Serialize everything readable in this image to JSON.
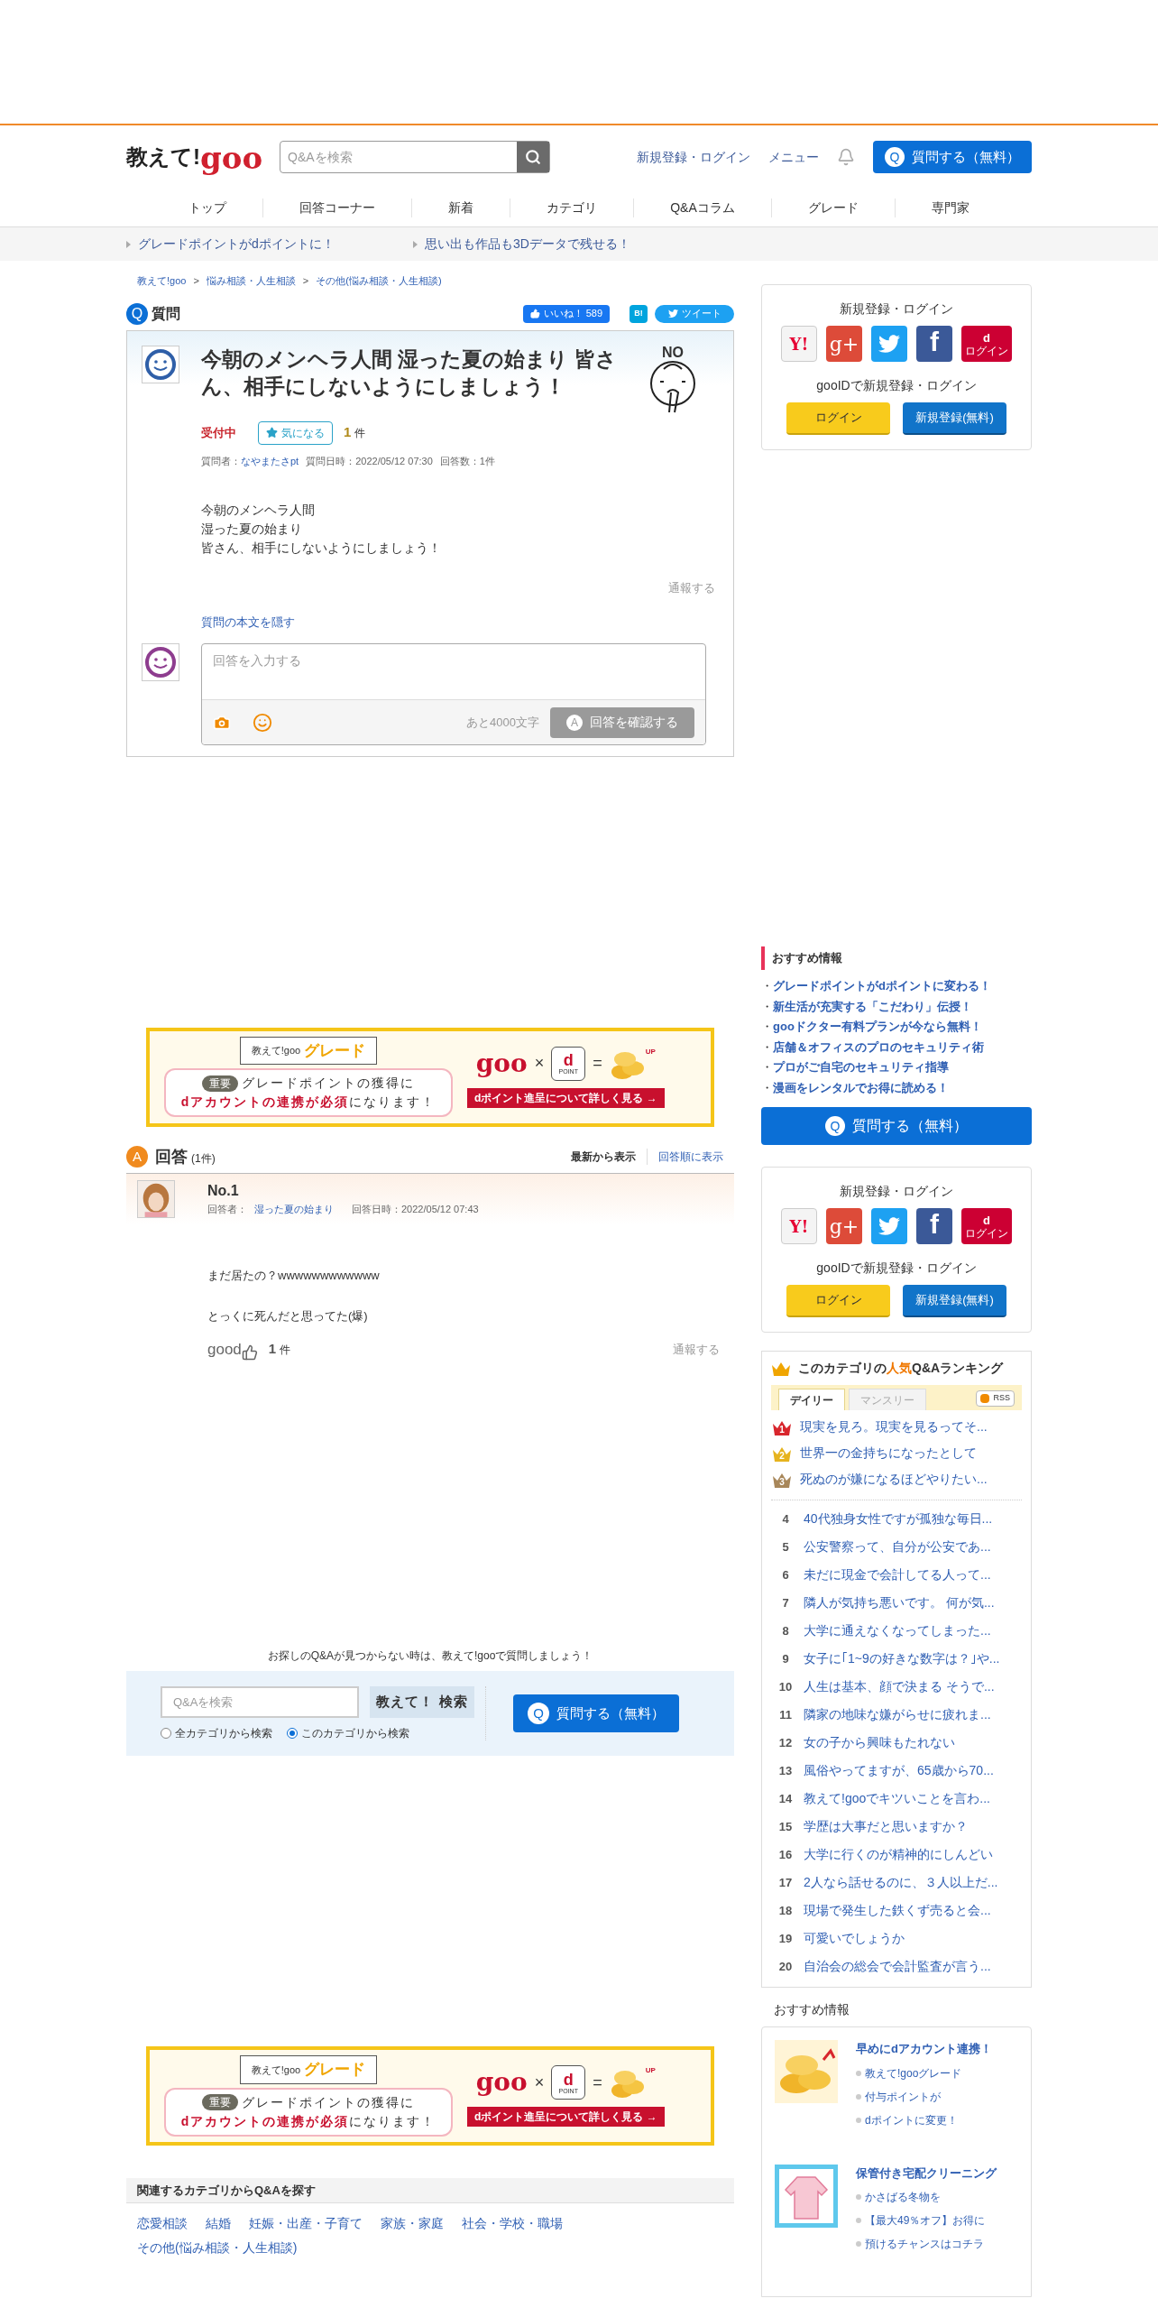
{
  "header": {
    "logo_text": "教えて!",
    "logo_brand": "goo",
    "search_placeholder": "Q&Aを検索",
    "links": [
      "新規登録・ログイン",
      "メニュー"
    ],
    "ask_icon": "Q",
    "ask_button": "質問する（無料）"
  },
  "nav": [
    "トップ",
    "回答コーナー",
    "新着",
    "カテゴリ",
    "Q&Aコラム",
    "グレード",
    "専門家"
  ],
  "promo_links": [
    "グレードポイントがdポイントに！",
    "思い出も作品も3Dデータで残せる！"
  ],
  "breadcrumb": {
    "items": [
      "教えて!goo",
      "悩み相談・人生相談",
      "その他(悩み相談・人生相談)"
    ],
    "separator": ">"
  },
  "question": {
    "badge": "Q",
    "heading": "質問",
    "like_label": "いいね！",
    "like_count": "589",
    "hatena": "B!",
    "tweet": "ツイート",
    "title": "今朝のメンヘラ人間 湿った夏の始まり 皆さん、相手にしないようにしましょう！",
    "illustration_text": "NO",
    "status": "受付中",
    "watch": "気になる",
    "watch_count": "1",
    "count_unit": "件",
    "asker_label": "質問者：",
    "asker": "なやまたさpt",
    "date": "質問日時：2022/05/12 07:30",
    "answer_count": "回答数：1件",
    "body": [
      "今朝のメンヘラ人間",
      "湿った夏の始まり",
      "皆さん、相手にしないようにしましょう！"
    ],
    "report": "通報する",
    "hide_link": "質問の本文を隠す",
    "answer_form": {
      "placeholder": "回答を入力する",
      "remaining": "あと4000文字",
      "submit_icon": "A",
      "submit": "回答を確認する",
      "disabled": true
    }
  },
  "banners": [
    {
      "brand_small": "教えて!goo",
      "grade": "グレード",
      "important": "重要",
      "line1": "グレードポイントの獲得に",
      "line2_highlight": "dアカウントの連携が必須",
      "line2_rest": "になります！",
      "goo": "goo",
      "times": "×",
      "dpoint_mark": "d",
      "dpoint_label": "POINT",
      "equals": "=",
      "up": "UP",
      "cta": "dポイント進呈について詳しく見る →"
    },
    {
      "brand_small": "教えて!goo",
      "grade": "グレード",
      "important": "重要",
      "line1": "グレードポイントの獲得に",
      "line2_highlight": "dアカウントの連携が必須",
      "line2_rest": "になります！",
      "goo": "goo",
      "times": "×",
      "dpoint_mark": "d",
      "dpoint_label": "POINT",
      "equals": "=",
      "up": "UP",
      "cta": "dポイント進呈について詳しく見る →"
    }
  ],
  "answers": {
    "badge": "A",
    "heading": "回答",
    "count": "(1件)",
    "sort": [
      {
        "label": "最新から表示",
        "selected": true
      },
      {
        "label": "回答順に表示",
        "selected": false
      }
    ],
    "items": [
      {
        "number": "No.1",
        "answerer_label": "回答者：",
        "answerer": "湿った夏の始まり",
        "date": "回答日時：2022/05/12 07:43",
        "body": [
          "まだ居たの？wwwwwwwwwwww",
          "とっくに死んだと思ってた(爆)"
        ],
        "good": "good",
        "good_count": "1",
        "good_unit": "件",
        "report": "通報する"
      }
    ]
  },
  "bottom_search": {
    "prompt": "お探しのQ&Aが見つからない時は、教えて!gooで質問しましょう！",
    "placeholder": "Q&Aを検索",
    "search_button": "教えて！ 検索",
    "scopes": [
      {
        "label": "全カテゴリから検索",
        "selected": false
      },
      {
        "label": "このカテゴリから検索",
        "selected": true
      }
    ],
    "ask_icon": "Q",
    "ask_button": "質問する（無料）"
  },
  "related": {
    "heading": "関連するカテゴリからQ&Aを探す",
    "links": [
      "恋愛相談",
      "結婚",
      "妊娠・出産・子育て",
      "家族・家庭",
      "社会・学校・職場",
      "その他(悩み相談・人生相談)"
    ]
  },
  "sidebar": {
    "login_cards": [
      {
        "heading": "新規登録・ログイン",
        "providers": [
          {
            "kind": "yahoo",
            "label": "Y!"
          },
          {
            "kind": "google",
            "label": "g+"
          },
          {
            "kind": "twitter"
          },
          {
            "kind": "facebook",
            "label": "f"
          },
          {
            "kind": "docomo",
            "label": "d",
            "sub": "ログイン"
          }
        ],
        "gooid": "gooIDで新規登録・ログイン",
        "login": "ログイン",
        "register": "新規登録(無料)"
      },
      {
        "heading": "新規登録・ログイン",
        "providers": [
          {
            "kind": "yahoo",
            "label": "Y!"
          },
          {
            "kind": "google",
            "label": "g+"
          },
          {
            "kind": "twitter"
          },
          {
            "kind": "facebook",
            "label": "f"
          },
          {
            "kind": "docomo",
            "label": "d",
            "sub": "ログイン"
          }
        ],
        "gooid": "gooIDで新規登録・ログイン",
        "login": "ログイン",
        "register": "新規登録(無料)"
      }
    ],
    "recommend": {
      "heading": "おすすめ情報",
      "bullet": "・",
      "links": [
        "グレードポイントがdポイントに変わる！",
        "新生活が充実する「こだわり」伝授！",
        "gooドクター有料プランが今なら無料！",
        "店舗＆オフィスのプロのセキュリティ術",
        "プロがご自宅のセキュリティ指導",
        "漫画をレンタルでお得に読める！"
      ]
    },
    "ask_icon": "Q",
    "ask_button": "質問する（無料）",
    "ranking": {
      "heading_pre": "このカテゴリの",
      "heading_hot": "人気",
      "heading_post": "Q&Aランキング",
      "tabs": [
        {
          "label": "デイリー",
          "selected": true
        },
        {
          "label": "マンスリー",
          "selected": false
        }
      ],
      "rss": "RSS",
      "top": [
        {
          "rank": "1",
          "title": "現実を見ろ。現実を見るってそ...",
          "color": "#d8262d"
        },
        {
          "rank": "2",
          "title": "世界一の金持ちになったとして",
          "color": "#e6b31e"
        },
        {
          "rank": "3",
          "title": "死ぬのが嫌になるほどやりたい...",
          "color": "#a8875a"
        }
      ],
      "rest": [
        {
          "rank": "4",
          "title": "40代独身女性ですが孤独な毎日..."
        },
        {
          "rank": "5",
          "title": "公安警察って、自分が公安であ..."
        },
        {
          "rank": "6",
          "title": "未だに現金で会計してる人って..."
        },
        {
          "rank": "7",
          "title": "隣人が気持ち悪いです。 何が気..."
        },
        {
          "rank": "8",
          "title": "大学に通えなくなってしまった..."
        },
        {
          "rank": "9",
          "title": "女子に｢1~9の好きな数字は？｣や..."
        },
        {
          "rank": "10",
          "title": "人生は基本、顔で決まる そうで..."
        },
        {
          "rank": "11",
          "title": "隣家の地味な嫌がらせに疲れま..."
        },
        {
          "rank": "12",
          "title": "女の子から興味もたれない"
        },
        {
          "rank": "13",
          "title": "風俗やってますが、65歳から70..."
        },
        {
          "rank": "14",
          "title": "教えて!gooでキツいことを言わ..."
        },
        {
          "rank": "15",
          "title": "学歴は大事だと思いますか？"
        },
        {
          "rank": "16",
          "title": "大学に行くのが精神的にしんどい"
        },
        {
          "rank": "17",
          "title": "2人なら話せるのに、３人以上だ..."
        },
        {
          "rank": "18",
          "title": "現場で発生した鉄くず売ると会..."
        },
        {
          "rank": "19",
          "title": "可愛いでしょうか"
        },
        {
          "rank": "20",
          "title": "自治会の総会で会計監査が言う..."
        }
      ]
    },
    "recommend2": {
      "heading": "おすすめ情報",
      "items": [
        {
          "kind": "coins",
          "title": "早めにdアカウント連携！",
          "lines": [
            "教えて!gooグレード",
            "付与ポイントが",
            "dポイントに変更！"
          ]
        },
        {
          "kind": "sweater",
          "title": "保管付き宅配クリーニング",
          "lines": [
            "かさばる冬物を",
            "【最大49％オフ】お得に",
            "預けるチャンスはコチラ"
          ]
        }
      ]
    }
  }
}
